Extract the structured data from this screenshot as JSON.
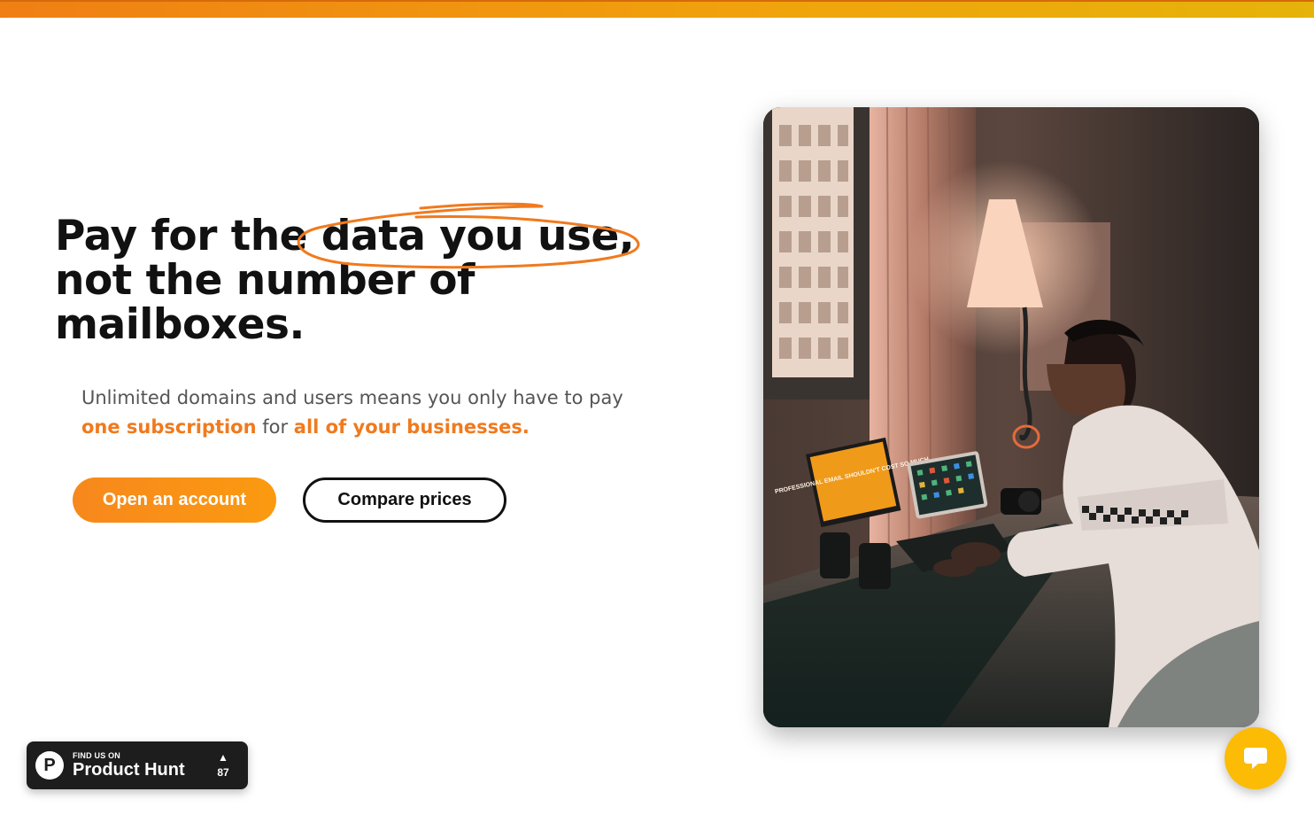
{
  "hero": {
    "title_line1_pre": "Pay for the ",
    "title_line1_highlight": "data you use,",
    "title_line2": "not the number of",
    "title_line3": "mailboxes.",
    "subtitle_part1": "Unlimited domains and users means you only have to pay ",
    "subtitle_highlight1": "one subscription",
    "subtitle_part2": " for ",
    "subtitle_highlight2": "all of your businesses."
  },
  "buttons": {
    "primary_label": "Open an account",
    "secondary_label": "Compare prices"
  },
  "photo": {
    "laptop_screen_text": "PROFESSIONAL EMAIL SHOULDN'T COST SO MUCH"
  },
  "product_hunt": {
    "kicker": "FIND US ON",
    "name": "Product Hunt",
    "logo_letter": "P",
    "arrow": "▲",
    "upvotes": "87"
  },
  "chat": {
    "icon": "chat-bubble-icon"
  },
  "colors": {
    "accent": "#f07a1e",
    "button_primary": "#f7881d",
    "chat": "#fcbb05",
    "top_bar": "#f0a40c"
  }
}
